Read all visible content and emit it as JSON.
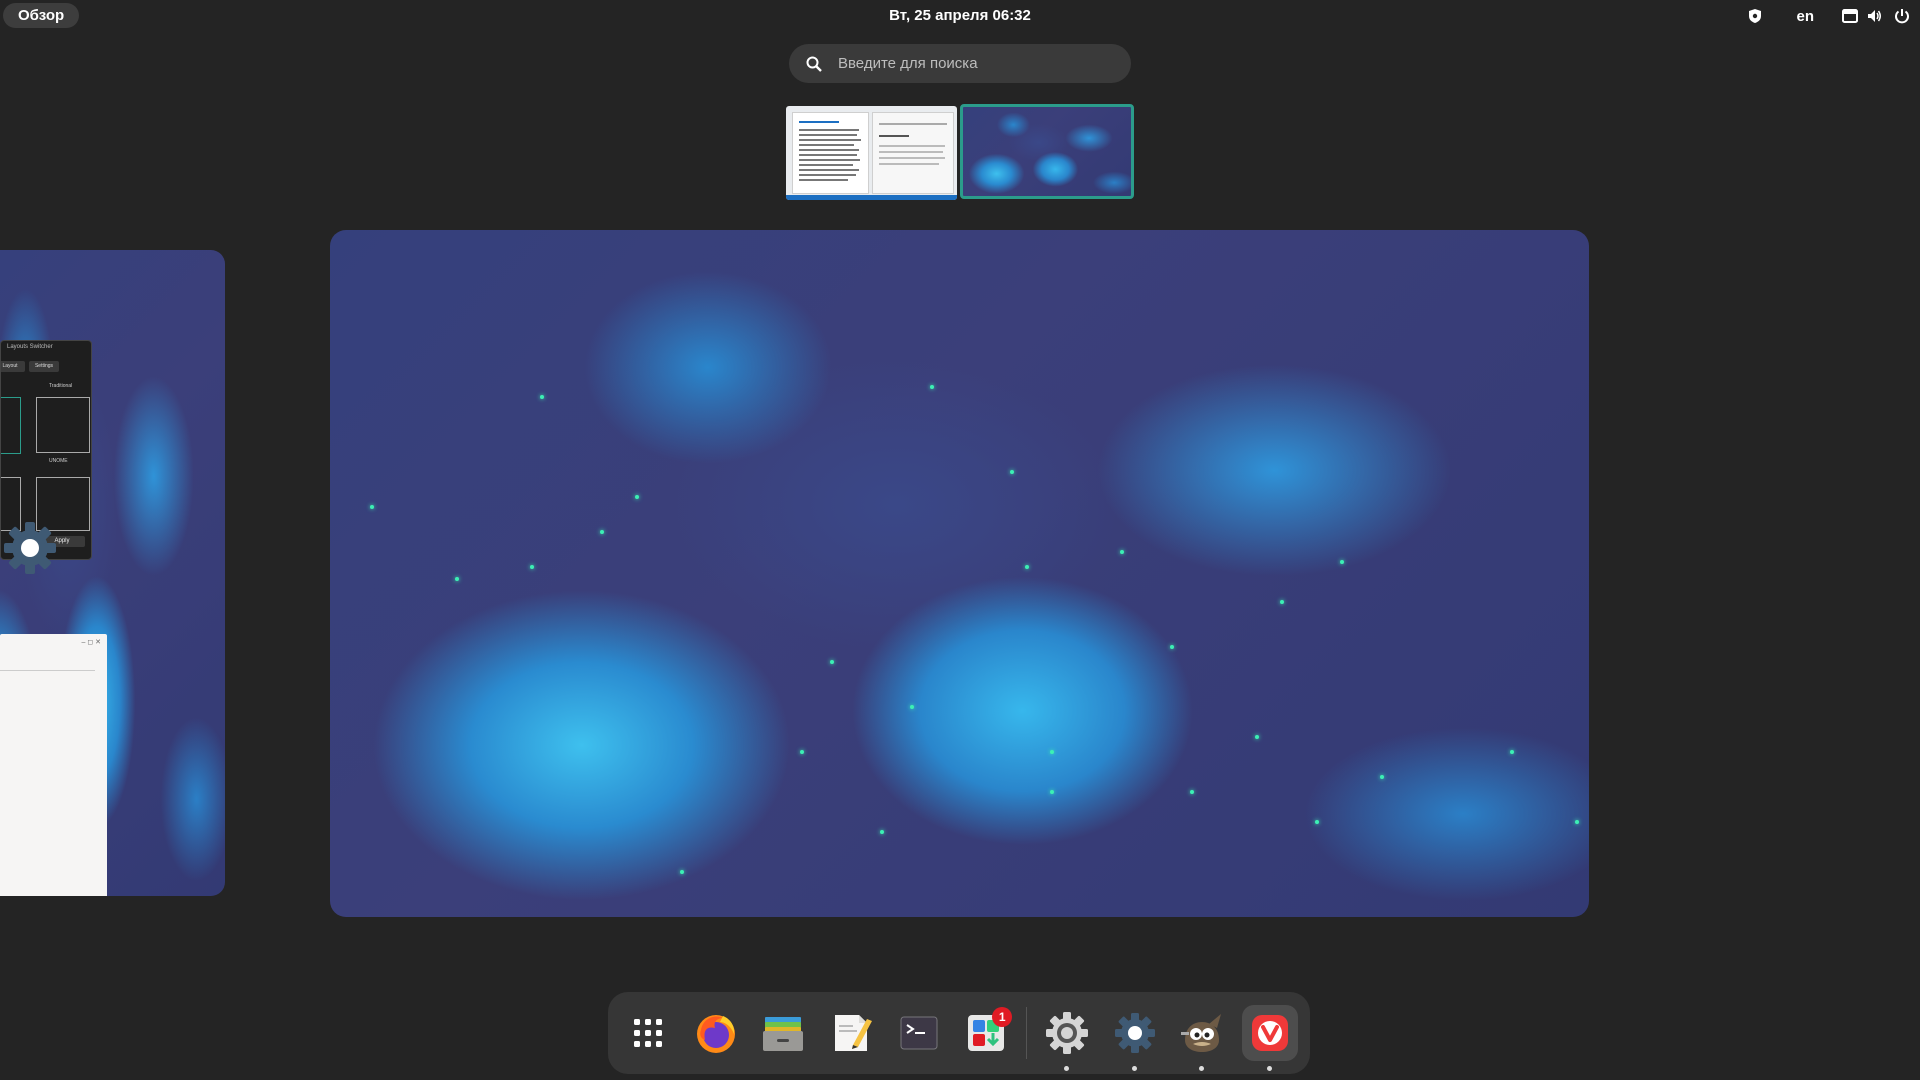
{
  "topbar": {
    "activities_label": "Обзор",
    "clock": "Вт, 25 апреля  06:32",
    "language": "en",
    "icons": [
      "shield-icon",
      "screen-icon",
      "volume-icon",
      "power-icon"
    ]
  },
  "search": {
    "placeholder": "Введите для поиска"
  },
  "left_window": {
    "title": "Layouts Switcher",
    "tabs": [
      "Layout",
      "Settings"
    ],
    "options": [
      "Traditional",
      "UNOME"
    ],
    "apply_label": "Apply"
  },
  "dock": {
    "apps": [
      {
        "name": "Show Applications",
        "icon": "apps-grid-icon"
      },
      {
        "name": "Firefox",
        "icon": "firefox-icon"
      },
      {
        "name": "Files",
        "icon": "files-icon"
      },
      {
        "name": "Text Editor",
        "icon": "text-editor-icon"
      },
      {
        "name": "Terminal",
        "icon": "terminal-icon"
      },
      {
        "name": "Software",
        "icon": "software-icon",
        "badge": "1"
      },
      {
        "name": "Settings",
        "icon": "settings-icon"
      },
      {
        "name": "Layouts Switcher",
        "icon": "layouts-gear-icon"
      },
      {
        "name": "GIMP",
        "icon": "gimp-icon"
      },
      {
        "name": "Vivaldi",
        "icon": "vivaldi-icon"
      }
    ],
    "software_badge": "1"
  },
  "colors": {
    "panel_bg": "#242424",
    "accent": "#2b9c8b",
    "dock_bg": "#363636",
    "badge": "#e01b24"
  }
}
